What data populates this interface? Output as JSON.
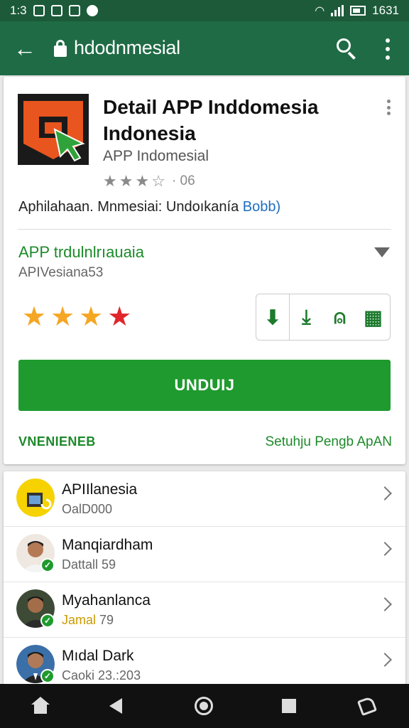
{
  "status_bar": {
    "time_left": "1:3",
    "time_right": "1631"
  },
  "app_bar": {
    "title": "hdodnmesial",
    "back_icon": "back-arrow-icon",
    "search_icon": "search-icon",
    "menu_icon": "more-vert-icon"
  },
  "app": {
    "name": "Detail APP Inddomesia Indonesia",
    "developer": "APP Indomesial",
    "rating_count": "· 06",
    "tagline": "Aphilahaan. Mnmesiai: Undoıkanía",
    "tagline_link": "Bobb)",
    "icon": "app-logo-icon"
  },
  "section": {
    "title": "APP trdulnlrıauaia",
    "subtitle": "APIVesiana53",
    "rating": 4
  },
  "actions": [
    {
      "icon": "download-icon",
      "label": "⬇"
    },
    {
      "icon": "arrow-down-icon",
      "label": "⤓"
    },
    {
      "icon": "person-icon",
      "label": "⍝"
    },
    {
      "icon": "gift-icon",
      "label": "▦"
    }
  ],
  "install_button": "UNDUIJ",
  "footer": {
    "left": "VNENIENEB",
    "right": "Setuhju Pengb ApAN"
  },
  "list": [
    {
      "name": "APIIlanesia",
      "sub": "OalD000",
      "sub_style": "normal",
      "avatar_color": "#f5d200"
    },
    {
      "name": "Manqiardham",
      "sub": "Dattall 59",
      "sub_style": "normal",
      "avatar_color": "#d9c3b0"
    },
    {
      "name": "Myahanlanca",
      "sub_gold": "Jamal",
      "sub_rest": "79",
      "sub_style": "gold",
      "avatar_color": "#5a4a3a"
    },
    {
      "name": "Mıdal Dark",
      "sub": "Caoki 23.:203",
      "sub_style": "normal",
      "avatar_color": "#3b6fa8"
    }
  ],
  "colors": {
    "app_bar": "#1f6b45",
    "status_bar": "#1c5a3a",
    "accent_green": "#1f9a2e",
    "star_yellow": "#f5a623",
    "star_red": "#e0262b",
    "link_blue": "#1e6fc0"
  }
}
